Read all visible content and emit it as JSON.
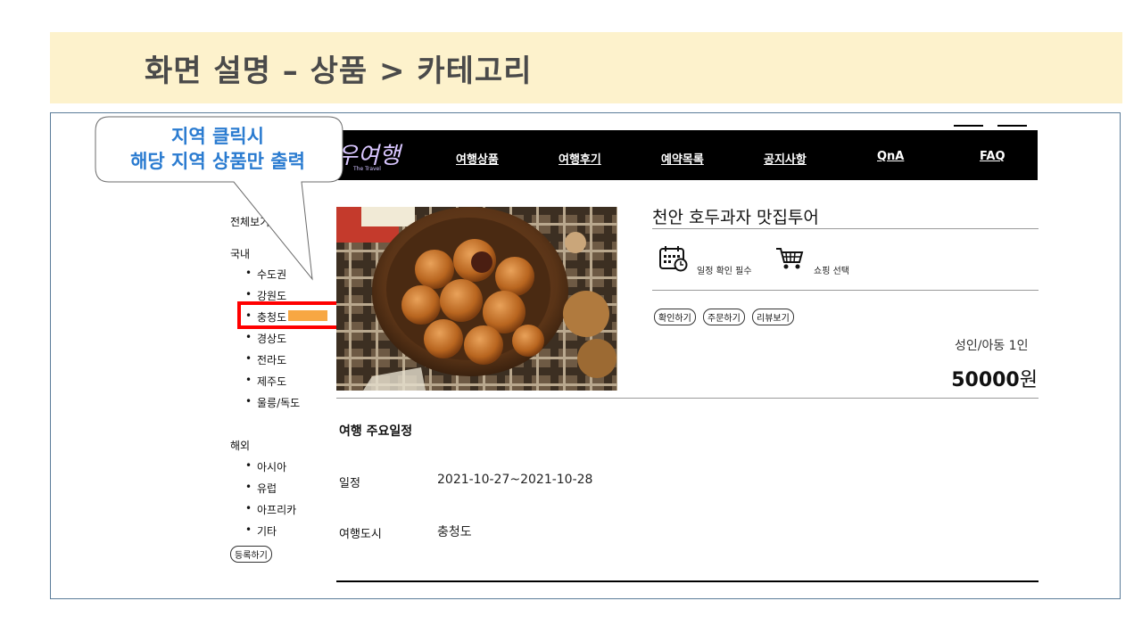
{
  "slide": {
    "title": "화면 설명 – 상품 > 카테고리"
  },
  "callout": {
    "line1": "지역 클릭시",
    "line2": "해당 지역 상품만 출력"
  },
  "brand": {
    "logo": "우여행",
    "sub": "The Travel"
  },
  "nav": [
    "여행상품",
    "여행후기",
    "예약목록",
    "공지사항",
    "QnA",
    "FAQ"
  ],
  "sidebar": {
    "all": "전체보기",
    "domestic_label": "국내",
    "domestic": [
      "수도권",
      "강원도",
      "충청도",
      "경상도",
      "전라도",
      "제주도",
      "울릉/독도"
    ],
    "overseas_label": "해외",
    "overseas": [
      "아시아",
      "유럽",
      "아프리카",
      "기타"
    ],
    "register_button": "등록하기",
    "selected": "충청도"
  },
  "product": {
    "title": "천안 호두과자 맛집투어",
    "schedule_note": "일정 확인 필수",
    "shopping_note": "쇼핑 선택",
    "buttons": [
      "확인하기",
      "주문하기",
      "리뷰보기"
    ],
    "price_label": "성인/아동 1인",
    "price_number": "50000",
    "price_unit": "원"
  },
  "itinerary": {
    "title": "여행 주요일정",
    "date_label": "일정",
    "date_value": "2021-10-27~2021-10-28",
    "city_label": "여행도시",
    "city_value": "충청도"
  },
  "colors": {
    "header_bg": "#fdf2cc",
    "callout_text": "#2a7bd0",
    "highlight": "#f7a743",
    "selection_box": "#ff0000"
  }
}
